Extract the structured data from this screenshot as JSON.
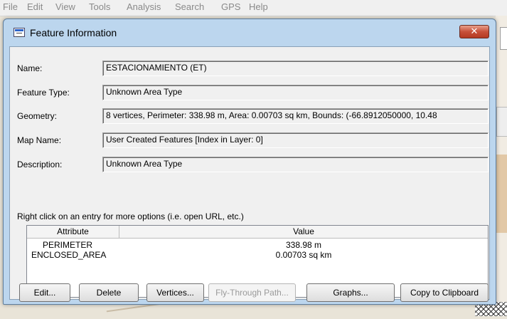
{
  "menu": [
    "File",
    "Edit",
    "View",
    "Tools",
    "Analysis",
    "Search",
    "GPS",
    "Help"
  ],
  "dialog": {
    "title": "Feature Information",
    "close_glyph": "✕",
    "fields": [
      {
        "label": "Name:",
        "value": "ESTACIONAMIENTO (ET)"
      },
      {
        "label": "Feature Type:",
        "value": "Unknown Area Type"
      },
      {
        "label": "Geometry:",
        "value": "8 vertices, Perimeter: 338.98 m, Area: 0.00703 sq km, Bounds: (-66.8912050000, 10.48"
      },
      {
        "label": "Map Name:",
        "value": "User Created Features [Index in Layer: 0]"
      },
      {
        "label": "Description:",
        "value": "Unknown Area Type"
      }
    ],
    "hint": "Right click on an entry for more options (i.e. open URL, etc.)",
    "table": {
      "headers": [
        "Attribute",
        "Value"
      ],
      "rows": [
        {
          "attribute": "PERIMETER",
          "value": "338.98 m"
        },
        {
          "attribute": "ENCLOSED_AREA",
          "value": "0.00703 sq km"
        }
      ]
    },
    "buttons": {
      "edit": "Edit...",
      "delete": "Delete",
      "vertices": "Vertices...",
      "flythrough": "Fly-Through Path...",
      "graphs": "Graphs...",
      "copy": "Copy to Clipboard"
    }
  }
}
